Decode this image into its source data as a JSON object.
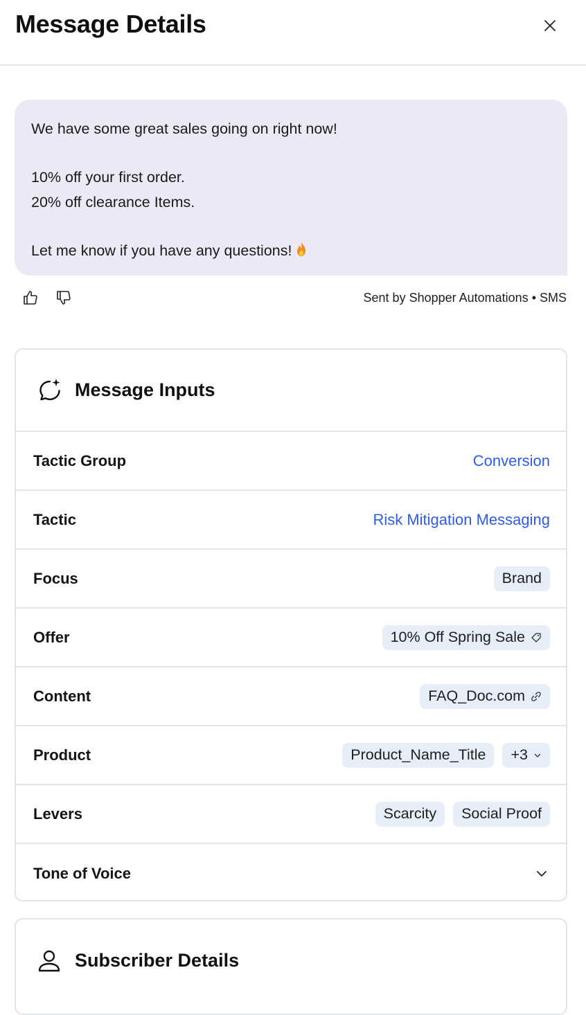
{
  "header": {
    "title": "Message Details"
  },
  "message": {
    "lines": [
      "We have some great sales going on right now!",
      "10% off your first order.",
      "20% off clearance Items.",
      "Let me know if you have any questions!"
    ],
    "emoji_icon": "fire-icon"
  },
  "meta": {
    "sent_by": "Sent by Shopper Automations • SMS"
  },
  "inputs": {
    "title": "Message Inputs",
    "rows": {
      "tactic_group": {
        "label": "Tactic Group",
        "value": "Conversion"
      },
      "tactic": {
        "label": "Tactic",
        "value": "Risk Mitigation Messaging"
      },
      "focus": {
        "label": "Focus",
        "value": "Brand"
      },
      "offer": {
        "label": "Offer",
        "value": "10% Off Spring Sale"
      },
      "content": {
        "label": "Content",
        "value": "FAQ_Doc.com"
      },
      "product": {
        "label": "Product",
        "value": "Product_Name_Title",
        "more": "+3"
      },
      "levers": {
        "label": "Levers",
        "values": [
          "Scarcity",
          "Social Proof"
        ]
      },
      "tone": {
        "label": "Tone of Voice"
      }
    }
  },
  "subscriber": {
    "title": "Subscriber Details"
  },
  "colors": {
    "link": "#2f5bea",
    "bubble": "#ebeaf4",
    "chip": "#e7eef8",
    "border": "#e3e4ea"
  }
}
